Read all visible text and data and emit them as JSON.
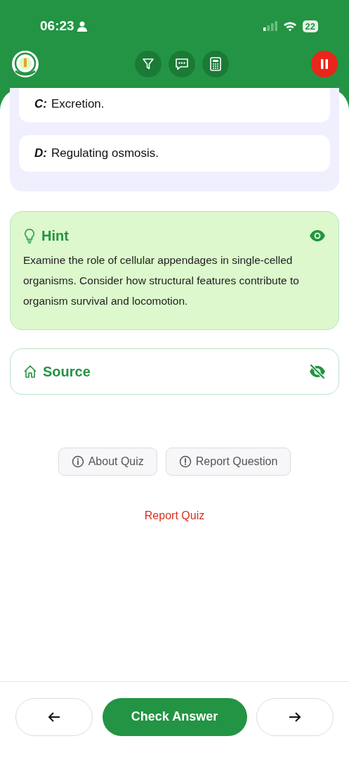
{
  "status_bar": {
    "time": "06:23",
    "battery": "22"
  },
  "options": [
    {
      "letter": "C:",
      "text": "Excretion.",
      "selected": false
    },
    {
      "letter": "D:",
      "text": "Regulating osmosis.",
      "selected": false
    }
  ],
  "hint": {
    "title": "Hint",
    "text": "Examine the role of cellular appendages in single-celled organisms. Consider how structural features contribute to organism survival and locomotion.",
    "revealed": true
  },
  "source": {
    "title": "Source",
    "revealed": false
  },
  "actions": [
    {
      "label": "About Quiz",
      "kind": "info"
    },
    {
      "label": "Report Question",
      "kind": "alert"
    }
  ],
  "report_link": "Report Quiz",
  "bottom_bar": {
    "check_button": "Check Answer"
  }
}
